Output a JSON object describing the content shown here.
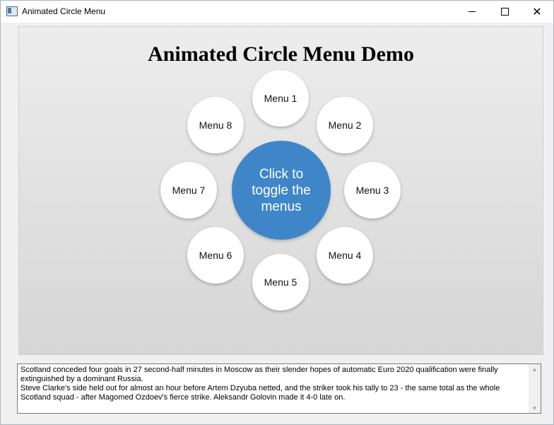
{
  "window": {
    "title": "Animated Circle Menu",
    "icon": "app-window-icon",
    "controls": {
      "minimize_icon": "minimize-icon",
      "maximize_icon": "maximize-icon",
      "close_icon": "close-icon",
      "close_glyph": "✕"
    }
  },
  "panel": {
    "title": "Animated Circle Menu Demo",
    "center_button": "Click to toggle the menus",
    "accent_color": "#3f86c9",
    "menus": [
      "Menu 1",
      "Menu 2",
      "Menu 3",
      "Menu 4",
      "Menu 5",
      "Menu 6",
      "Menu 7",
      "Menu 8"
    ]
  },
  "textbox": {
    "lines": [
      "Scotland conceded four goals in 27 second-half minutes in Moscow as their slender hopes of automatic Euro 2020 qualification were finally extinguished by a dominant Russia.",
      "Steve Clarke's side held out for almost an hour before Artem Dzyuba netted, and the striker took his tally to 23 - the same total as the whole Scotland squad - after Magomed Ozdoev's fierce strike. Aleksandr Golovin made it 4-0 late on."
    ],
    "scroll_up": "▲",
    "scroll_down": "▼"
  }
}
